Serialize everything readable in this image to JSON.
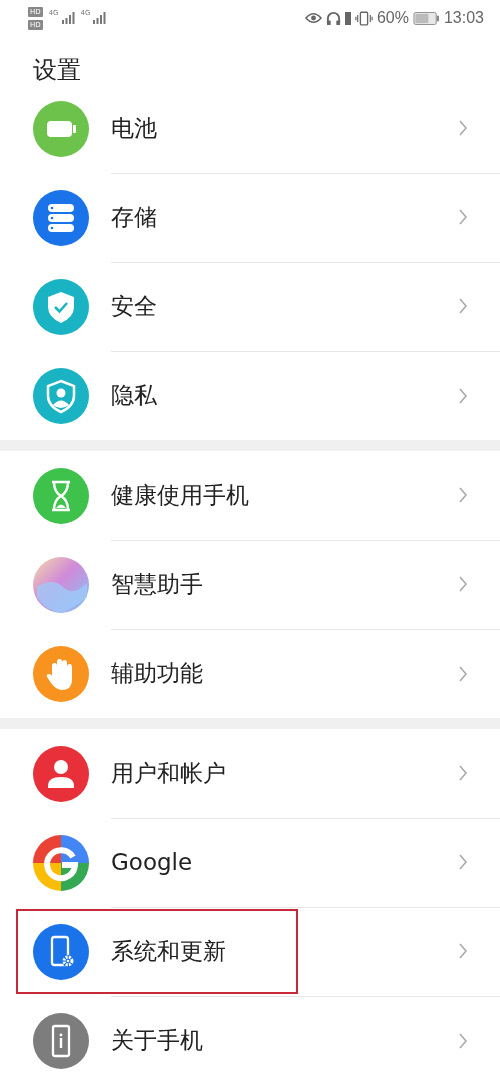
{
  "status_bar": {
    "sim_labels": [
      {
        "hd": "HD",
        "net": "4G"
      },
      {
        "hd": "HD",
        "net": "4G"
      }
    ],
    "battery_percent": "60%",
    "time": "13:03"
  },
  "title": "设置",
  "groups": [
    {
      "items": [
        {
          "label": "电池",
          "kind": "battery",
          "highlighted": false
        },
        {
          "label": "存储",
          "kind": "storage",
          "highlighted": false
        },
        {
          "label": "安全",
          "kind": "security",
          "highlighted": false
        },
        {
          "label": "隐私",
          "kind": "privacy",
          "highlighted": false
        }
      ]
    },
    {
      "items": [
        {
          "label": "健康使用手机",
          "kind": "hourglass",
          "highlighted": false
        },
        {
          "label": "智慧助手",
          "kind": "assistant",
          "highlighted": false
        },
        {
          "label": "辅助功能",
          "kind": "hand",
          "highlighted": false
        }
      ]
    },
    {
      "items": [
        {
          "label": "用户和帐户",
          "kind": "user",
          "highlighted": false
        },
        {
          "label": "Google",
          "kind": "google",
          "highlighted": false
        },
        {
          "label": "系统和更新",
          "kind": "system",
          "highlighted": true
        },
        {
          "label": "关于手机",
          "kind": "about",
          "highlighted": false
        }
      ]
    }
  ]
}
